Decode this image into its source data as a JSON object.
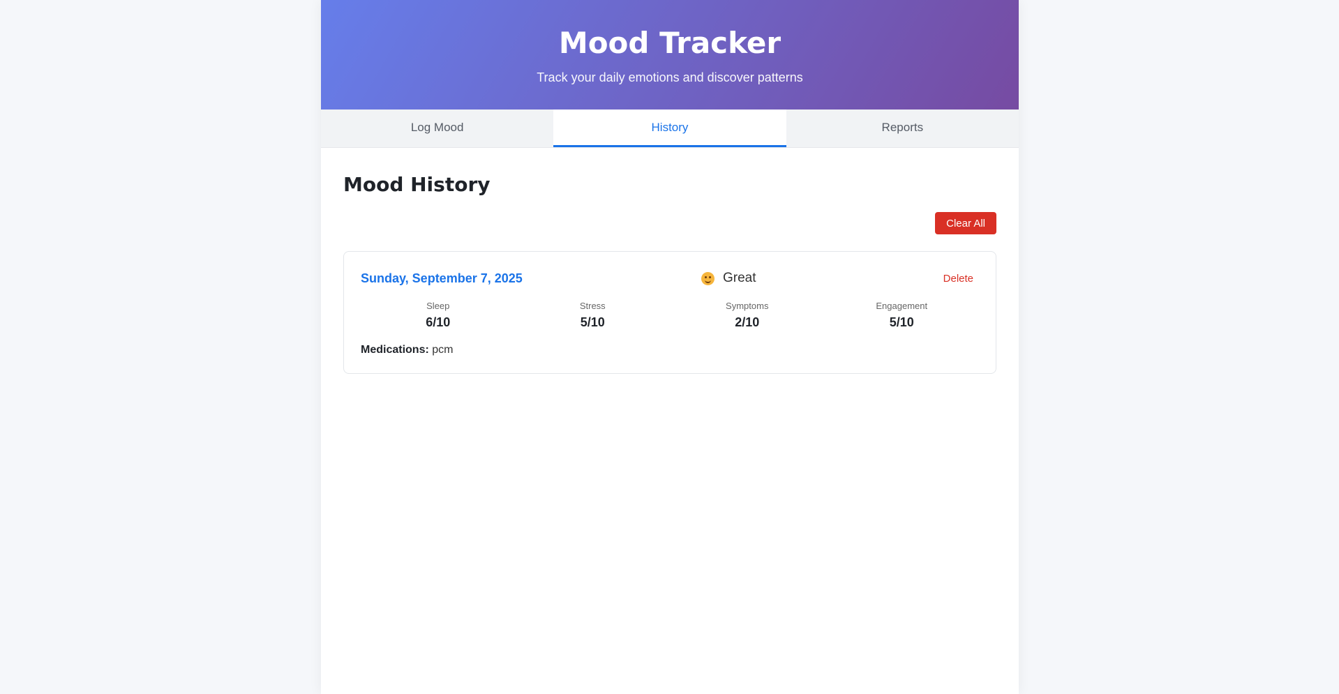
{
  "header": {
    "title": "Mood Tracker",
    "subtitle": "Track your daily emotions and discover patterns"
  },
  "tabs": [
    {
      "label": "Log Mood",
      "active": false
    },
    {
      "label": "History",
      "active": true
    },
    {
      "label": "Reports",
      "active": false
    }
  ],
  "history": {
    "title": "Mood History",
    "clear_all_label": "Clear All",
    "entries": [
      {
        "date": "Sunday, September 7, 2025",
        "mood_icon": "smiling-face-icon",
        "mood": "Great",
        "delete_label": "Delete",
        "metrics": [
          {
            "label": "Sleep",
            "value": "6/10"
          },
          {
            "label": "Stress",
            "value": "5/10"
          },
          {
            "label": "Symptoms",
            "value": "2/10"
          },
          {
            "label": "Engagement",
            "value": "5/10"
          }
        ],
        "medications_label": "Medications:",
        "medications": "pcm"
      }
    ]
  },
  "colors": {
    "header_gradient_start": "#667eea",
    "header_gradient_end": "#764ba2",
    "accent": "#1a73e8",
    "danger": "#d93025"
  }
}
